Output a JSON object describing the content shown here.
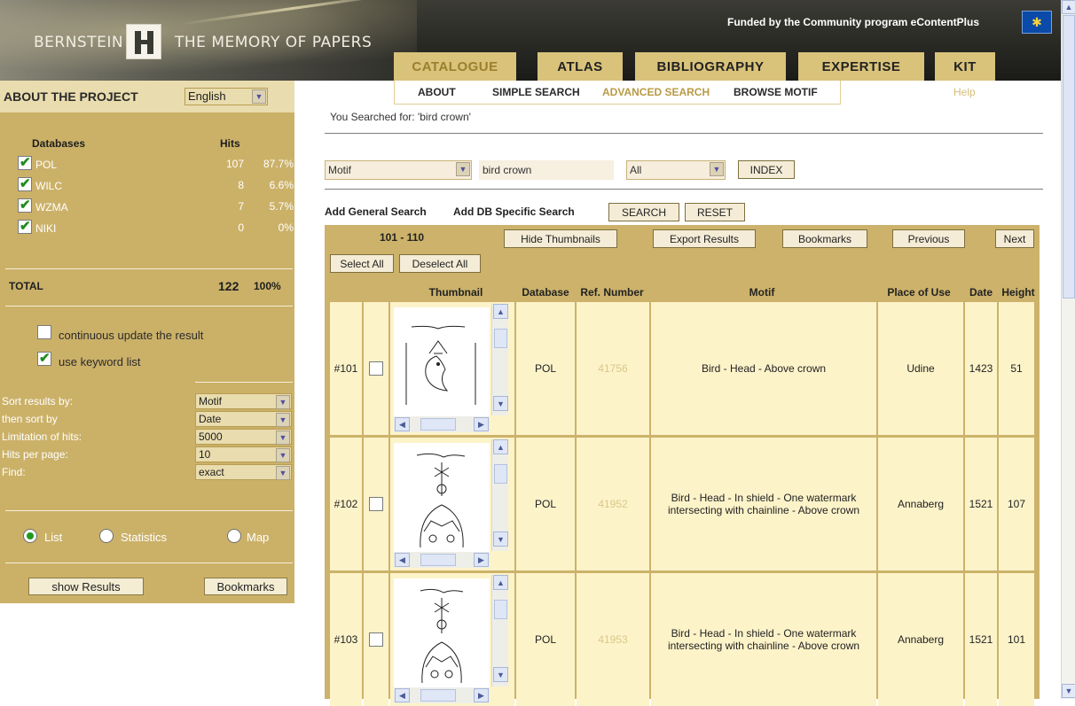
{
  "header": {
    "brand_left": "BERNSTEIN",
    "brand_right": "THE MEMORY OF PAPERS",
    "funded": "Funded by the Community program eContentPlus",
    "nav": [
      {
        "label": "CATALOGUE",
        "active": true
      },
      {
        "label": "ATLAS",
        "active": false
      },
      {
        "label": "BIBLIOGRAPHY",
        "active": false
      },
      {
        "label": "EXPERTISE",
        "active": false
      },
      {
        "label": "KIT",
        "active": false
      }
    ]
  },
  "sub_nav": {
    "items": [
      {
        "label": "ABOUT",
        "active": false
      },
      {
        "label": "SIMPLE SEARCH",
        "active": false
      },
      {
        "label": "ADVANCED SEARCH",
        "active": true
      },
      {
        "label": "BROWSE MOTIF",
        "active": false
      }
    ],
    "help": "Help"
  },
  "sidebar": {
    "title": "ABOUT THE PROJECT",
    "language": "English",
    "db_header": {
      "name": "Databases",
      "hits": "Hits"
    },
    "databases": [
      {
        "name": "POL",
        "hits": "107",
        "pct": "87.7%",
        "checked": true
      },
      {
        "name": "WILC",
        "hits": "8",
        "pct": "6.6%",
        "checked": true
      },
      {
        "name": "WZMA",
        "hits": "7",
        "pct": "5.7%",
        "checked": true
      },
      {
        "name": "NIKI",
        "hits": "0",
        "pct": "0%",
        "checked": true
      }
    ],
    "total": {
      "label": "TOTAL",
      "hits": "122",
      "pct": "100%"
    },
    "options": [
      {
        "label": "continuous update the result",
        "checked": false
      },
      {
        "label": "use keyword list",
        "checked": true
      }
    ],
    "sort": [
      {
        "label": "Sort results by:",
        "value": "Motif"
      },
      {
        "label": "then sort by",
        "value": "Date"
      },
      {
        "label": "Limitation of hits:",
        "value": "5000"
      },
      {
        "label": "Hits per page:",
        "value": "10"
      },
      {
        "label": "Find:",
        "value": "exact"
      }
    ],
    "views": [
      {
        "label": "List",
        "selected": true
      },
      {
        "label": "Statistics",
        "selected": false
      },
      {
        "label": "Map",
        "selected": false
      }
    ],
    "show_results": "show Results",
    "bookmarks": "Bookmarks"
  },
  "search": {
    "searched_prefix": "You Searched for:",
    "searched_term": "'bird crown'",
    "field": "Motif",
    "query": "bird crown",
    "scope": "All",
    "index_btn": "INDEX",
    "add_general": "Add General Search",
    "add_db": "Add DB Specific Search",
    "search_btn": "SEARCH",
    "reset_btn": "RESET"
  },
  "results": {
    "range": "101 - 110",
    "hide_thumbs": "Hide Thumbnails",
    "export": "Export Results",
    "bookmarks": "Bookmarks",
    "previous": "Previous",
    "next": "Next",
    "select_all": "Select All",
    "deselect_all": "Deselect All",
    "columns": [
      "Thumbnail",
      "Database",
      "Ref. Number",
      "Motif",
      "Place of Use",
      "Date",
      "Height"
    ],
    "rows": [
      {
        "num": "#101",
        "db": "POL",
        "ref": "41756",
        "motif": "Bird - Head - Above crown",
        "place": "Udine",
        "date": "1423",
        "height": "51"
      },
      {
        "num": "#102",
        "db": "POL",
        "ref": "41952",
        "motif": "Bird - Head - In shield - One watermark intersecting with chainline - Above crown",
        "place": "Annaberg",
        "date": "1521",
        "height": "107"
      },
      {
        "num": "#103",
        "db": "POL",
        "ref": "41953",
        "motif": "Bird - Head - In shield - One watermark intersecting with chainline - Above crown",
        "place": "Annaberg",
        "date": "1521",
        "height": "101"
      }
    ]
  }
}
